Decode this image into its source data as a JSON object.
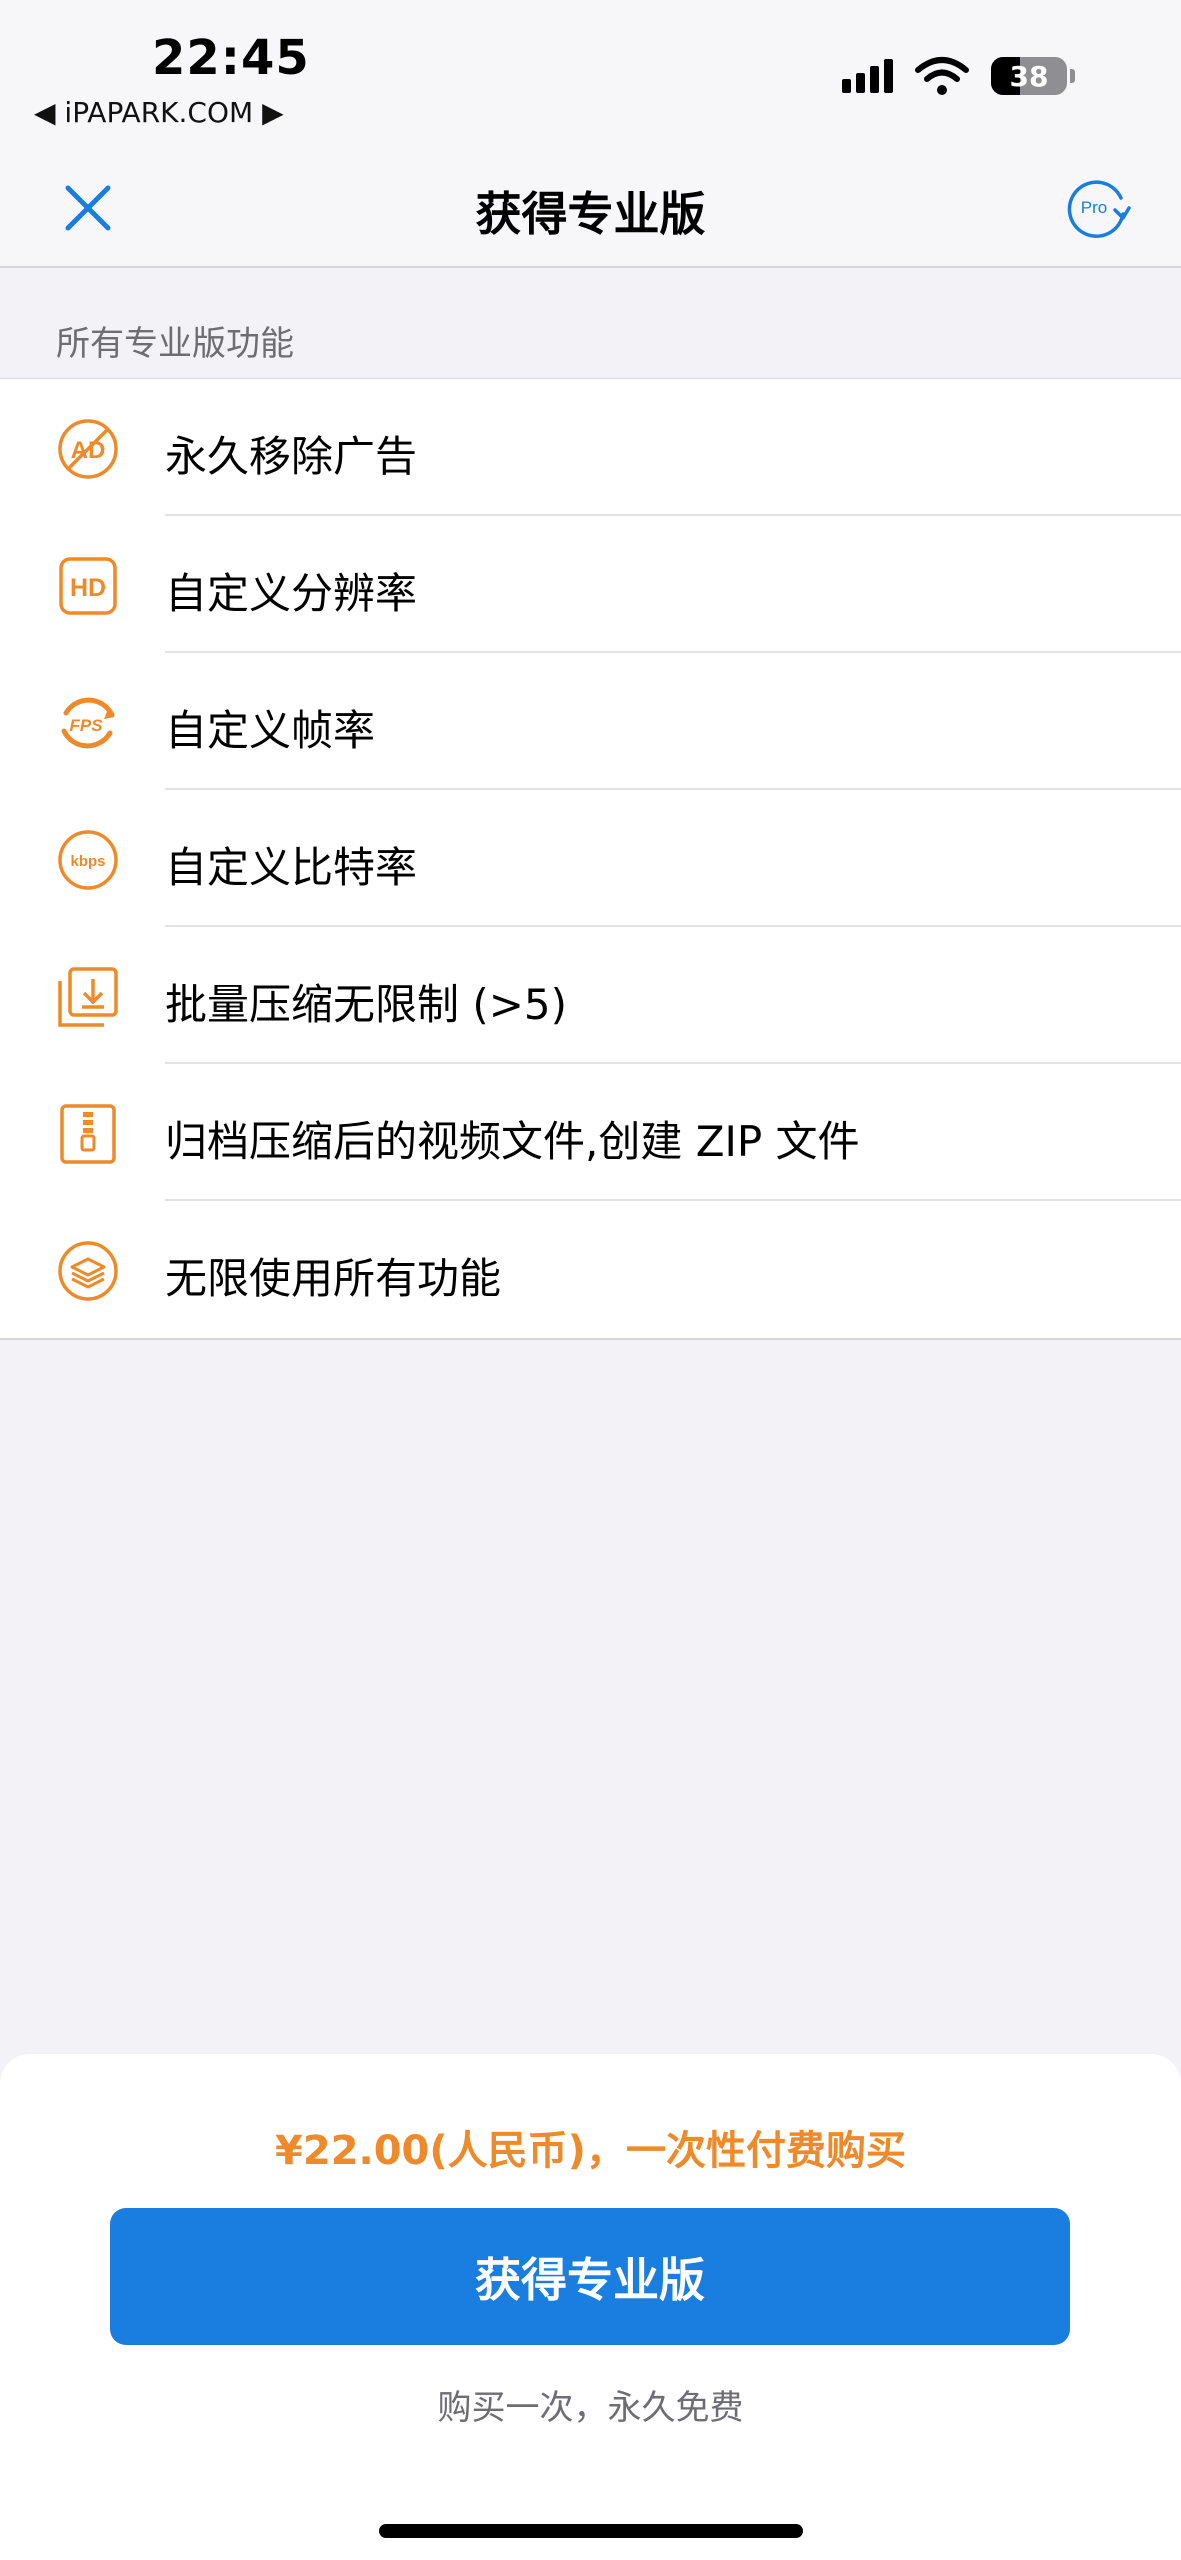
{
  "status_bar": {
    "time": "22:45",
    "back_label": "◀ iPAPARK.COM ▶",
    "battery_level": "38",
    "battery_fraction": 0.38
  },
  "nav": {
    "title": "获得专业版",
    "close_icon": "close-x-icon",
    "restore_icon": "pro-restore-icon",
    "restore_icon_text": "Pro"
  },
  "section_header": "所有专业版功能",
  "features": [
    {
      "icon": "no-ads-icon",
      "label": "永久移除广告"
    },
    {
      "icon": "hd-icon",
      "label": "自定义分辨率"
    },
    {
      "icon": "fps-icon",
      "label": "自定义帧率"
    },
    {
      "icon": "kbps-icon",
      "label": "自定义比特率"
    },
    {
      "icon": "batch-download-icon",
      "label": "批量压缩无限制 (>5)"
    },
    {
      "icon": "zip-archive-icon",
      "label": "归档压缩后的视频文件,创建 ZIP 文件"
    },
    {
      "icon": "layers-icon",
      "label": "无限使用所有功能"
    }
  ],
  "purchase": {
    "price_text": "¥22.00(人民币)，一次性付费购买",
    "button_label": "获得专业版",
    "note": "购买一次，永久免费"
  },
  "colors": {
    "accent_blue": "#1a7de0",
    "accent_orange": "#ee8a2a",
    "background": "#f2f2f7"
  }
}
